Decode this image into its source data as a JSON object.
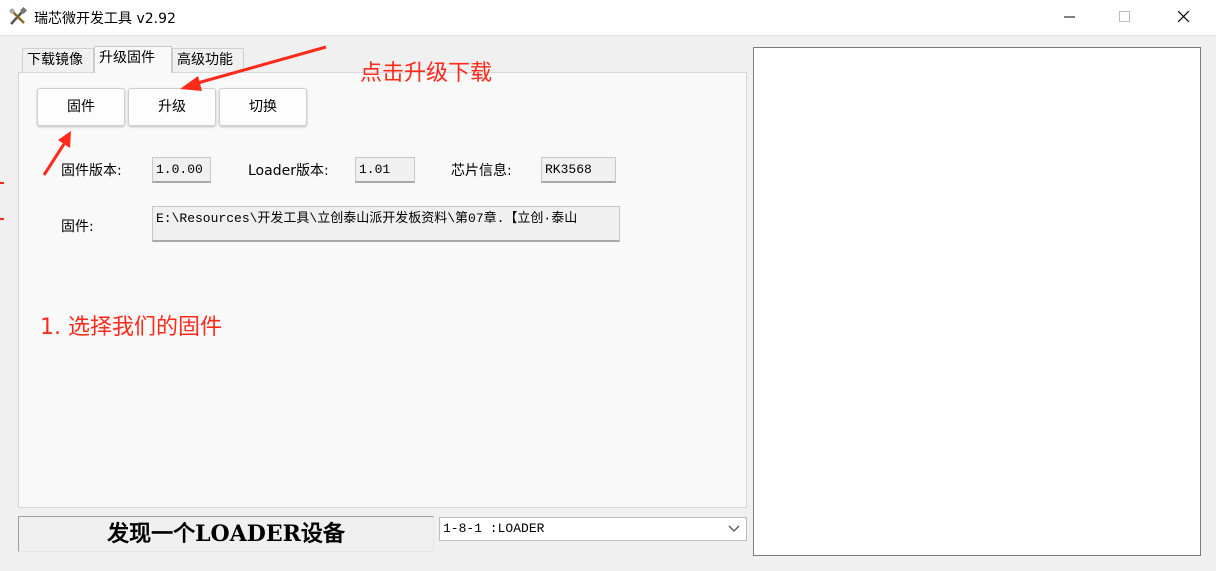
{
  "window": {
    "title": "瑞芯微开发工具 v2.92",
    "app_icon": "tools-icon",
    "controls": {
      "minimize": "minimize-icon",
      "maximize": "maximize-icon",
      "close": "close-icon"
    }
  },
  "tabs": [
    {
      "label": "下载镜像",
      "active": false
    },
    {
      "label": "升级固件",
      "active": true
    },
    {
      "label": "高级功能",
      "active": false
    }
  ],
  "toolbar": {
    "firmware_button": "固件",
    "upgrade_button": "升级",
    "switch_button": "切换"
  },
  "info": {
    "firmware_version_label": "固件版本:",
    "firmware_version_value": "1.0.00",
    "loader_version_label": "Loader版本:",
    "loader_version_value": "1.01",
    "chip_info_label": "芯片信息:",
    "chip_info_value": "RK3568",
    "firmware_label": "固件:",
    "firmware_path": "E:\\Resources\\开发工具\\立创泰山派开发板资料\\第07章.【立创·泰山"
  },
  "annotations": {
    "click_upgrade": "点击升级下载",
    "select_firmware": "1. 选择我们的固件",
    "color": "#ff2a1a"
  },
  "status": {
    "message": "发现一个LOADER设备",
    "device_selected": "1-8-1 :LOADER"
  },
  "colors": {
    "window_bg": "#f0f0f0",
    "panel_bg": "#f9f9f9",
    "annotation_red": "#ff2a1a"
  }
}
